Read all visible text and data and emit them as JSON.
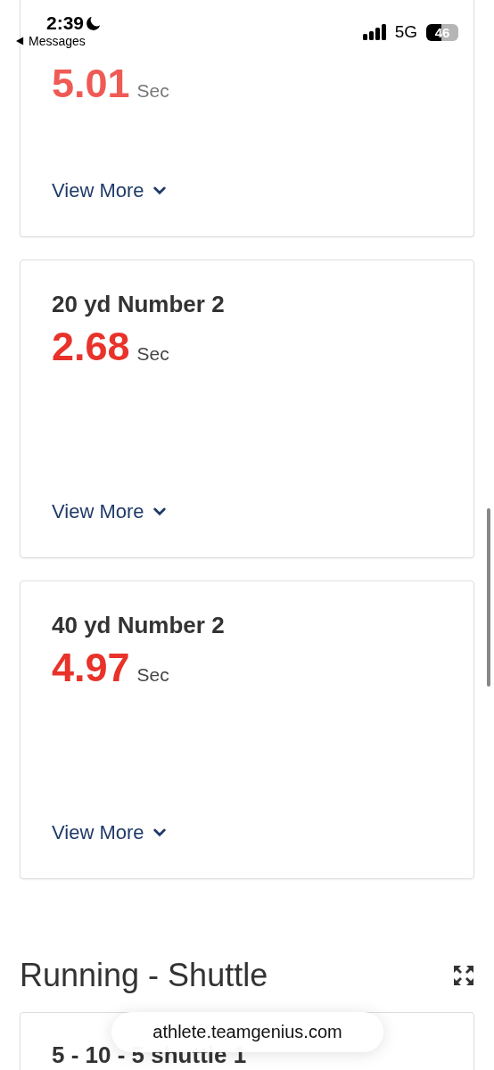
{
  "status_bar": {
    "time": "2:39",
    "back_label": "Messages",
    "network": "5G",
    "battery": {
      "label": "46",
      "level": 0.46
    }
  },
  "cards": [
    {
      "value": "5.01",
      "unit": "Sec",
      "link": "View More"
    },
    {
      "title": "20 yd Number 2",
      "value": "2.68",
      "unit": "Sec",
      "link": "View More"
    },
    {
      "title": "40 yd Number 2",
      "value": "4.97",
      "unit": "Sec",
      "link": "View More"
    }
  ],
  "sections": [
    {
      "title": "Running - Shuttle",
      "cards": [
        {
          "title": "5 - 10 - 5 shuttle 1"
        }
      ]
    }
  ],
  "url_bar": {
    "url": "athlete.teamgenius.com"
  }
}
